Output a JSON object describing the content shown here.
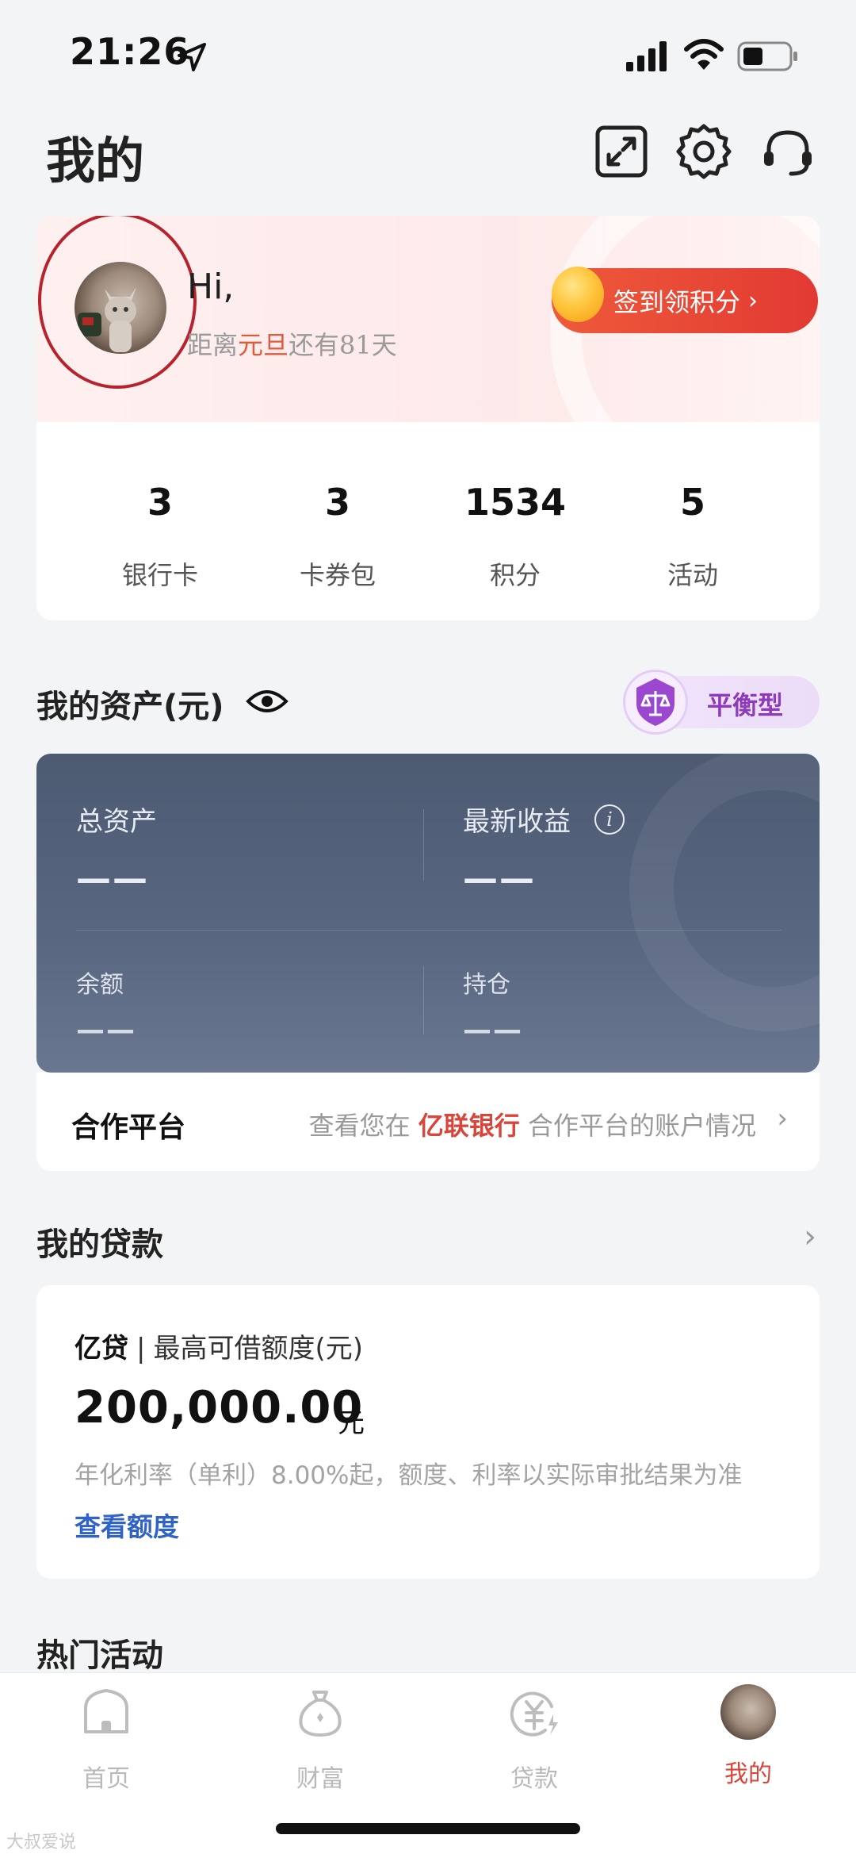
{
  "status_bar": {
    "time": "21:26"
  },
  "header": {
    "title": "我的",
    "icons": [
      "expand-icon",
      "gear-icon",
      "headset-icon"
    ]
  },
  "profile": {
    "greeting": "Hi,",
    "countdown_prefix": "距离",
    "countdown_holiday": "元旦",
    "countdown_suffix": "还有",
    "countdown_days": "81",
    "countdown_unit": "天",
    "sign_in_label": "签到领积分",
    "sign_in_chevron": "›",
    "stats": [
      {
        "value": "3",
        "label": "银行卡"
      },
      {
        "value": "3",
        "label": "卡券包"
      },
      {
        "value": "1534",
        "label": "积分"
      },
      {
        "value": "5",
        "label": "活动"
      }
    ]
  },
  "assets": {
    "title": "我的资产(元)",
    "risk_type": "平衡型",
    "total_label": "总资产",
    "total_value": "——",
    "earnings_label": "最新收益",
    "earnings_info": "i",
    "earnings_value": "——",
    "balance_label": "余额",
    "balance_value": "——",
    "holdings_label": "持仓",
    "holdings_value": "——"
  },
  "partner": {
    "title": "合作平台",
    "desc_prefix": "查看您在",
    "bank": "亿联银行",
    "desc_suffix": "合作平台的账户情况",
    "chevron": "›"
  },
  "loans": {
    "title": "我的贷款",
    "chevron": "›",
    "product": "亿贷",
    "separator": "|",
    "limit_label": "最高可借额度(元)",
    "amount": "200,000.00",
    "unit": "元",
    "rate_note": "年化利率（单利）8.00%起，额度、利率以实际审批结果为准",
    "link": "查看额度"
  },
  "hot": {
    "title": "热门活动"
  },
  "tabbar": {
    "items": [
      {
        "label": "首页",
        "icon": "home-icon",
        "active": false
      },
      {
        "label": "财富",
        "icon": "wealth-icon",
        "active": false
      },
      {
        "label": "贷款",
        "icon": "loan-icon",
        "active": false
      },
      {
        "label": "我的",
        "icon": "avatar",
        "active": true
      }
    ]
  },
  "colors": {
    "accent": "#d8453a",
    "asset_card": "#56637c",
    "link": "#2f63c8",
    "risk": "#8d3bb8"
  },
  "watermark": "大叔爱说"
}
